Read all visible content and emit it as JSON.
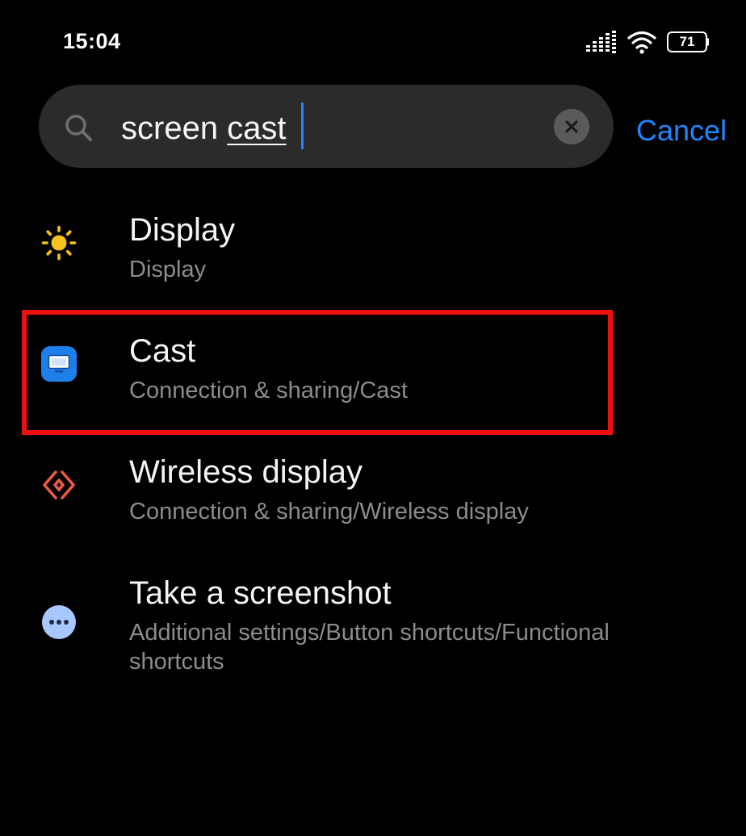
{
  "status_bar": {
    "time": "15:04",
    "battery_level": "71",
    "icons": [
      "signal-icon",
      "wifi-icon",
      "battery-icon"
    ]
  },
  "search": {
    "query_prefix": "screen ",
    "query_underlined": "cast",
    "cancel_label": "Cancel",
    "clear_icon": "close-icon"
  },
  "colors": {
    "accent": "#1f86ff",
    "highlight": "#ee1010",
    "display_icon": "#f7c21f",
    "cast_icon": "#1f7fe8",
    "wireless_icon": "#ef5b45",
    "more_icon": "#a8c7ff"
  },
  "results": [
    {
      "icon": "sun-icon",
      "title": "Display",
      "path": "Display"
    },
    {
      "icon": "cast-screen-icon",
      "title": "Cast",
      "path": "Connection & sharing/Cast"
    },
    {
      "icon": "wireless-display-icon",
      "title": "Wireless display",
      "path": "Connection & sharing/Wireless display"
    },
    {
      "icon": "more-icon",
      "title": "Take a screenshot",
      "path": "Additional settings/Button shortcuts/Functional shortcuts"
    }
  ]
}
